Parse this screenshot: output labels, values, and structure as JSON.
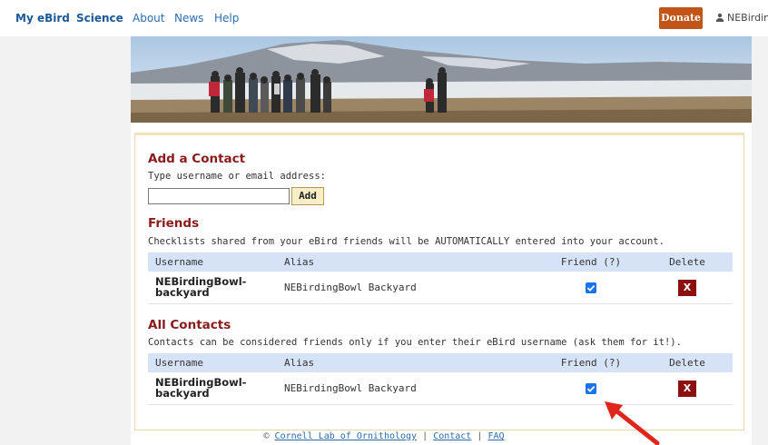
{
  "nav": {
    "my_ebird": "My eBird",
    "science": "Science",
    "about": "About",
    "news": "News",
    "help": "Help",
    "donate": "Donate",
    "user": "NEBirdingBowl"
  },
  "add_contact": {
    "title": "Add a Contact",
    "instruction": "Type username or email address:",
    "input_value": "",
    "add_label": "Add"
  },
  "friends": {
    "title": "Friends",
    "description": "Checklists shared from your eBird friends will be AUTOMATICALLY entered into your account.",
    "columns": [
      "Username",
      "Alias",
      "Friend (?)",
      "Delete"
    ],
    "rows": [
      {
        "username_line1": "NEBirdingBowl-",
        "username_line2": "backyard",
        "alias": "NEBirdingBowl Backyard",
        "friend": true,
        "delete": "X"
      }
    ]
  },
  "all_contacts": {
    "title": "All Contacts",
    "description": "Contacts can be considered friends only if you enter their eBird username (ask them for it!).",
    "columns": [
      "Username",
      "Alias",
      "Friend (?)",
      "Delete"
    ],
    "rows": [
      {
        "username_line1": "NEBirdingBowl-",
        "username_line2": "backyard",
        "alias": "NEBirdingBowl Backyard",
        "friend": true,
        "delete": "X"
      }
    ]
  },
  "footer": {
    "copyright": "©",
    "cornell": "Cornell Lab of Ornithology",
    "sep1": "|",
    "contact": "Contact",
    "sep2": "|",
    "faq": "FAQ"
  },
  "colors": {
    "accent_heading": "#8a1b1b",
    "donate": "#c0551a",
    "table_header": "#d6e3f7",
    "checkbox": "#1a73e8",
    "delete": "#8b1010",
    "annotation_arrow": "#e0261c"
  },
  "icons": [
    "user-icon",
    "checkbox-checked-icon",
    "delete-x-icon",
    "annotation-arrow-icon"
  ]
}
